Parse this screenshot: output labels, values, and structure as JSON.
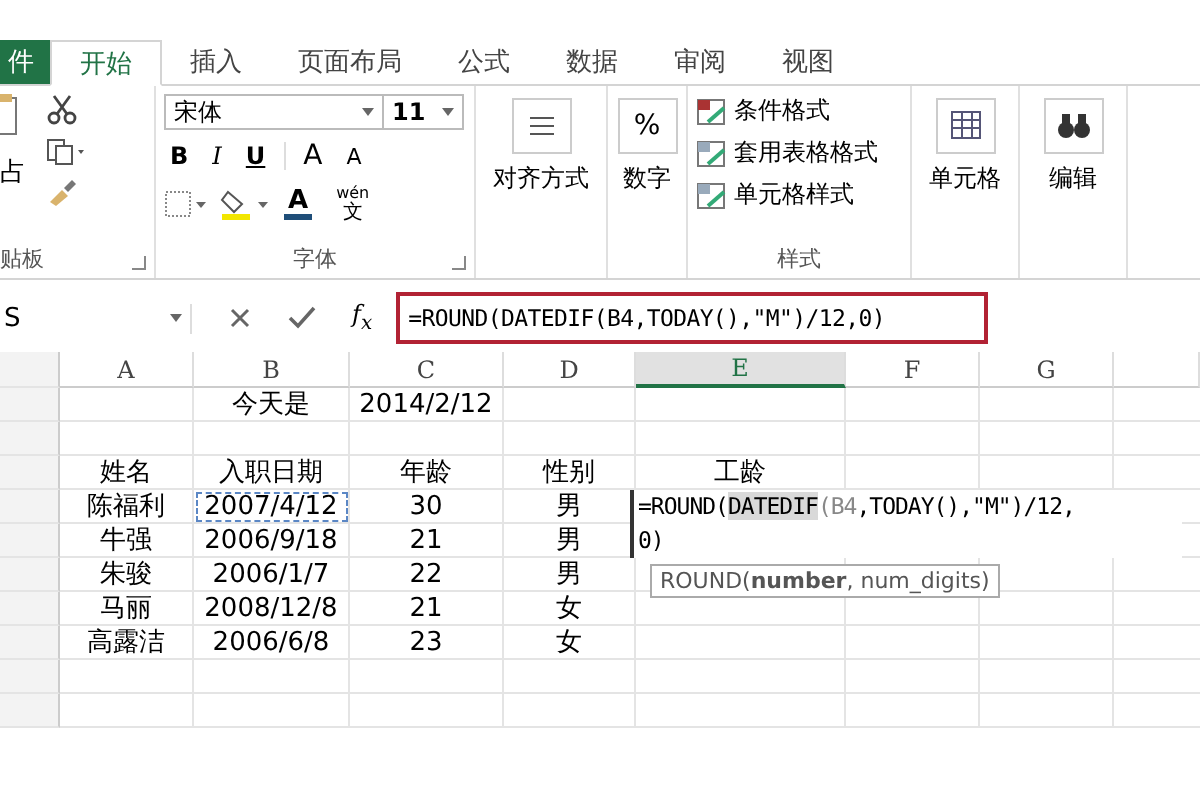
{
  "ribbon_tabs": [
    {
      "label": "件",
      "kind": "file",
      "selected": false
    },
    {
      "label": "开始",
      "kind": "tab",
      "selected": true
    },
    {
      "label": "插入",
      "kind": "tab",
      "selected": false
    },
    {
      "label": "页面布局",
      "kind": "tab",
      "selected": false
    },
    {
      "label": "公式",
      "kind": "tab",
      "selected": false
    },
    {
      "label": "数据",
      "kind": "tab",
      "selected": false
    },
    {
      "label": "审阅",
      "kind": "tab",
      "selected": false
    },
    {
      "label": "视图",
      "kind": "tab",
      "selected": false
    }
  ],
  "clipboard": {
    "paste_label": "占",
    "group_label": "贴板"
  },
  "font": {
    "name": "宋体",
    "size": "11",
    "bold": "B",
    "italic": "I",
    "underline": "U",
    "grow": "A",
    "shrink": "A",
    "font_color": "A",
    "phonetic_top": "wén",
    "phonetic_bottom": "文",
    "group_label": "字体"
  },
  "alignment": {
    "label": "对齐方式"
  },
  "number": {
    "symbol": "%",
    "label": "数字"
  },
  "styles": {
    "items": [
      "条件格式",
      "套用表格格式",
      "单元格样式"
    ],
    "group_label": "样式"
  },
  "cells": {
    "label": "单元格"
  },
  "editing": {
    "label": "编辑"
  },
  "name_box": "S",
  "fx": "f$_{x}$",
  "formula": "=ROUND(DATEDIF(B4,TODAY(),\"M\")/12,0)",
  "columns": [
    {
      "label": "A",
      "selected": false
    },
    {
      "label": "B",
      "selected": false
    },
    {
      "label": "C",
      "selected": false
    },
    {
      "label": "D",
      "selected": false
    },
    {
      "label": "E",
      "selected": true
    },
    {
      "label": "F",
      "selected": false
    },
    {
      "label": "G",
      "selected": false
    }
  ],
  "rows": [
    {
      "cells": {
        "B": "今天是",
        "C": "2014/2/12"
      }
    },
    {
      "cells": {}
    },
    {
      "cells": {
        "A": "姓名",
        "B": "入职日期",
        "C": "年龄",
        "D": "性别",
        "E": "工龄"
      }
    },
    {
      "cells": {
        "A": "陈福利",
        "B": {
          "text": "2007/4/12",
          "copy_marquee": true
        },
        "C": "30",
        "D": "男"
      }
    },
    {
      "cells": {
        "A": "牛强",
        "B": "2006/9/18",
        "C": "21",
        "D": "男"
      }
    },
    {
      "cells": {
        "A": "朱骏",
        "B": "2006/1/7",
        "C": "22",
        "D": "男"
      }
    },
    {
      "cells": {
        "A": "马丽",
        "B": "2008/12/8",
        "C": "21",
        "D": "女"
      }
    },
    {
      "cells": {
        "A": "高露洁",
        "B": "2006/6/8",
        "C": "23",
        "D": "女"
      }
    },
    {
      "cells": {}
    },
    {
      "cells": {}
    }
  ],
  "cell_editor": {
    "lines": [
      [
        {
          "text": "=ROUND(",
          "kind": "plain"
        },
        {
          "text": "DATEDIF",
          "kind": "highlight"
        },
        {
          "text": "(B4",
          "kind": "ref"
        },
        {
          "text": ",TODAY(),\"M\")/12,",
          "kind": "plain"
        }
      ],
      [
        {
          "text": "0)",
          "kind": "plain"
        }
      ]
    ]
  },
  "tooltip": "ROUND(**number**, num_digits)"
}
